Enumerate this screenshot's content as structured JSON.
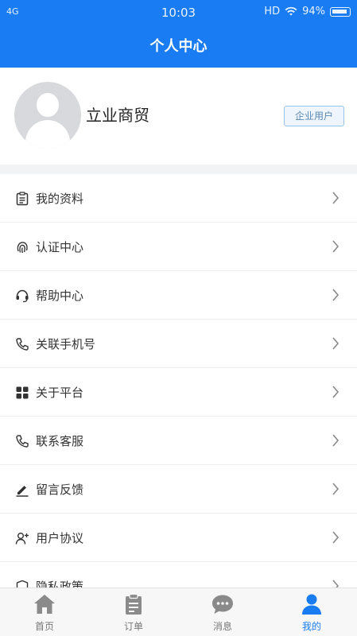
{
  "status_bar": {
    "network": "4G",
    "time": "10:03",
    "hd": "HD",
    "battery": "94%"
  },
  "header": {
    "title": "个人中心"
  },
  "profile": {
    "name": "立业商贸",
    "badge": "企业用户"
  },
  "menu": {
    "items": [
      {
        "label": "我的资料",
        "icon": "profile-doc-icon"
      },
      {
        "label": "认证中心",
        "icon": "fingerprint-icon"
      },
      {
        "label": "帮助中心",
        "icon": "headset-icon"
      },
      {
        "label": "关联手机号",
        "icon": "phone-icon"
      },
      {
        "label": "关于平台",
        "icon": "grid-icon"
      },
      {
        "label": "联系客服",
        "icon": "phone-icon"
      },
      {
        "label": "留言反馈",
        "icon": "pen-icon"
      },
      {
        "label": "用户协议",
        "icon": "user-add-icon"
      },
      {
        "label": "隐私政策",
        "icon": "shield-icon"
      }
    ]
  },
  "tabbar": {
    "tabs": [
      {
        "label": "首页",
        "icon": "home-icon"
      },
      {
        "label": "订单",
        "icon": "clipboard-icon"
      },
      {
        "label": "消息",
        "icon": "chat-icon"
      },
      {
        "label": "我的",
        "icon": "person-icon",
        "active": true
      }
    ]
  },
  "colors": {
    "accent": "#1a7cf2",
    "tab_inactive": "#777777"
  }
}
